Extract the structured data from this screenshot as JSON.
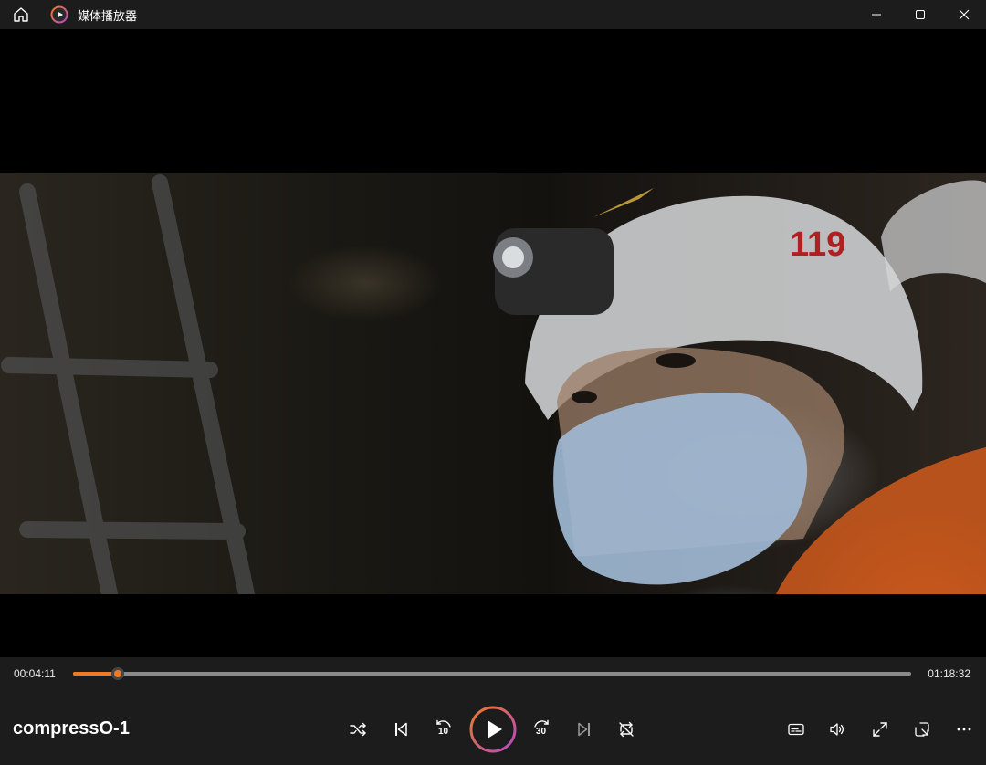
{
  "window": {
    "title": "媒体播放器",
    "icons": [
      "home-icon",
      "media-player-logo-icon",
      "minimize-icon",
      "maximize-icon",
      "close-icon"
    ]
  },
  "video": {
    "description_visible": false,
    "helmet_text": "119"
  },
  "playback": {
    "current_time": "00:04:11",
    "total_time": "01:18:32",
    "progress": 0.0532,
    "state": "paused"
  },
  "media": {
    "title": "compressO-1"
  },
  "controls": {
    "center": [
      "shuffle-icon",
      "previous-icon",
      "rewind-10-icon",
      "play-icon",
      "forward-30-icon",
      "next-icon",
      "repeat-off-icon"
    ],
    "rewind_label": "10",
    "forward_label": "30",
    "right": [
      "subtitles-icon",
      "volume-icon",
      "fullscreen-icon",
      "mini-player-icon",
      "more-icon"
    ]
  },
  "colors": {
    "accent": "#f07a24",
    "play_ring_start": "#f07a24",
    "play_ring_end": "#b04ac8",
    "chrome": "#1c1c1c"
  }
}
